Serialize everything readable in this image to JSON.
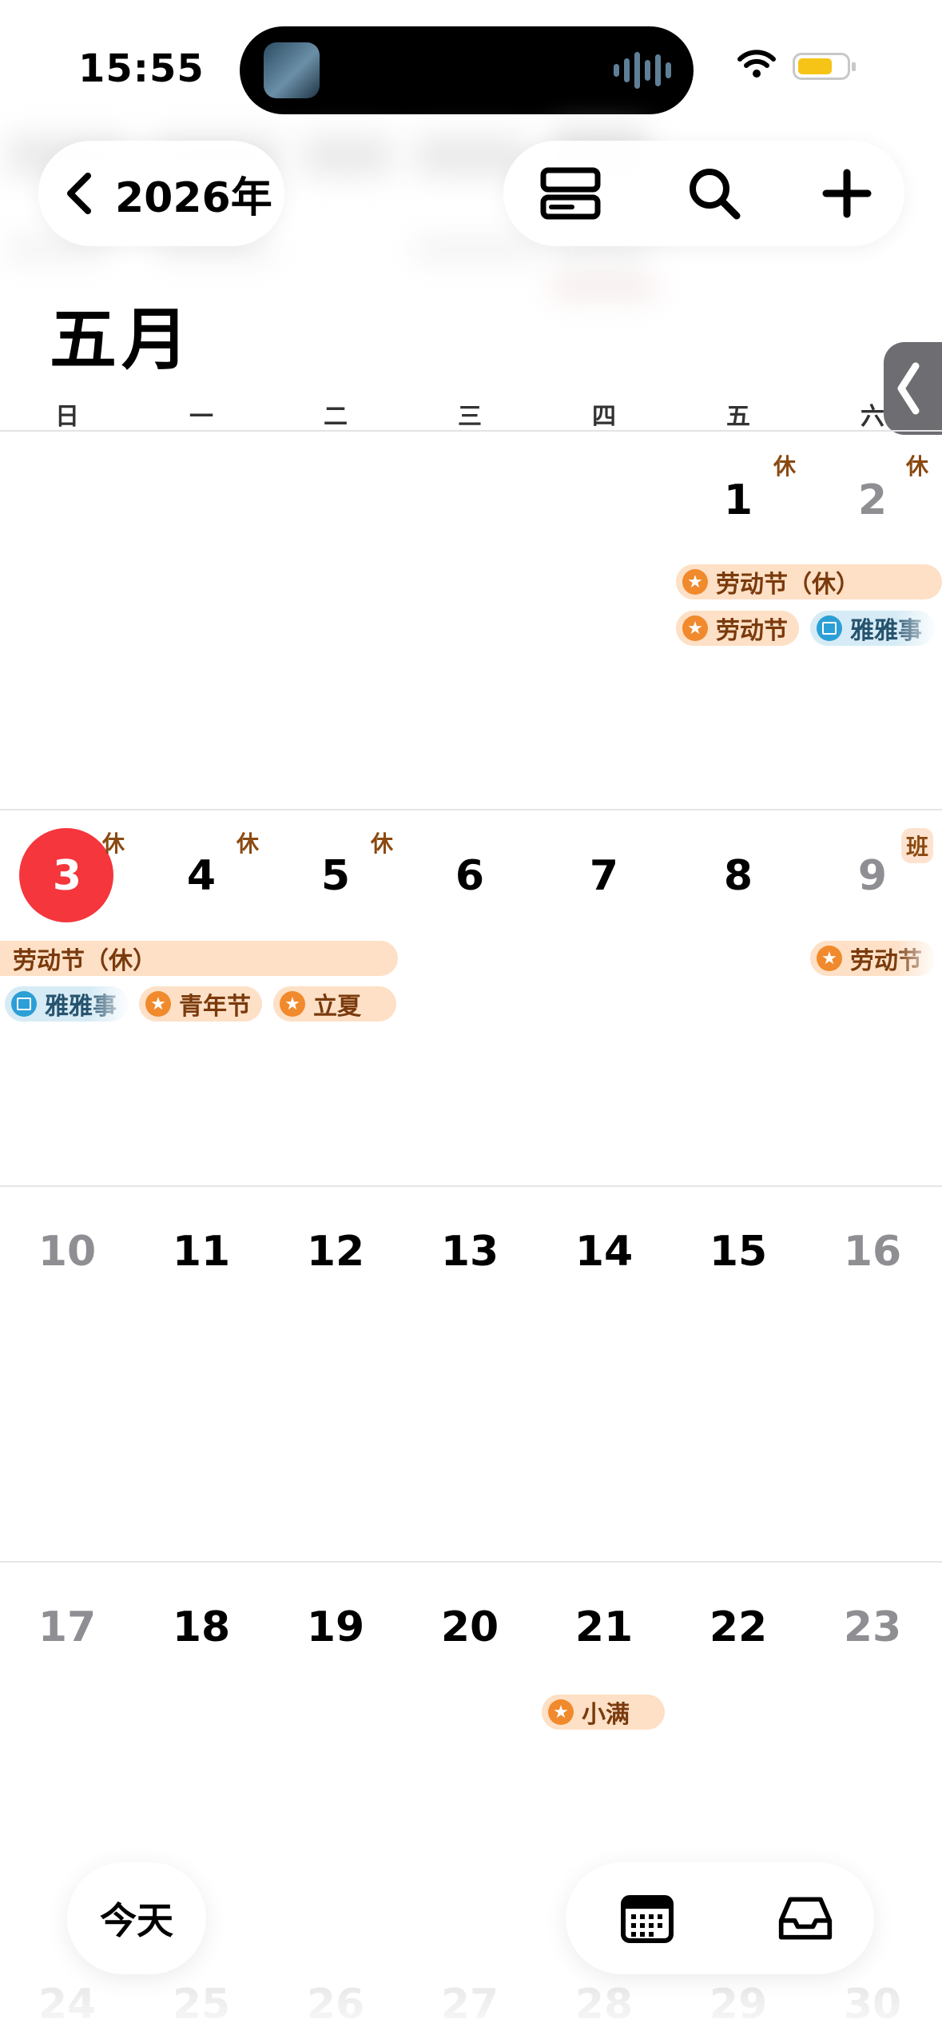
{
  "status_bar": {
    "time": "15:55"
  },
  "header": {
    "back_label": "2026年",
    "month_title": "五月"
  },
  "weekdays": [
    "日",
    "一",
    "二",
    "三",
    "四",
    "五",
    "六"
  ],
  "weeks": [
    {
      "days": [
        {
          "n": "",
          "style": "normal"
        },
        {
          "n": "",
          "style": "normal"
        },
        {
          "n": "",
          "style": "normal"
        },
        {
          "n": "",
          "style": "normal"
        },
        {
          "n": "",
          "style": "normal"
        },
        {
          "n": "1",
          "style": "normal",
          "badge": "休"
        },
        {
          "n": "2",
          "style": "dim",
          "badge": "休"
        }
      ],
      "events": [
        {
          "label": "劳动节（休）",
          "type": "banner"
        },
        {
          "label": "劳动节",
          "type": "holiday"
        },
        {
          "label": "雅雅事",
          "type": "calendar"
        }
      ]
    },
    {
      "days": [
        {
          "n": "3",
          "style": "today",
          "badge": "休"
        },
        {
          "n": "4",
          "style": "normal",
          "badge": "休"
        },
        {
          "n": "5",
          "style": "normal",
          "badge": "休"
        },
        {
          "n": "6",
          "style": "normal"
        },
        {
          "n": "7",
          "style": "normal"
        },
        {
          "n": "8",
          "style": "normal"
        },
        {
          "n": "9",
          "style": "dim",
          "badge": "班"
        }
      ],
      "events": [
        {
          "label": "劳动节（休）",
          "type": "banner"
        },
        {
          "label": "雅雅事",
          "type": "calendar"
        },
        {
          "label": "青年节",
          "type": "holiday"
        },
        {
          "label": "立夏",
          "type": "holiday"
        },
        {
          "label": "劳动节",
          "type": "holiday"
        }
      ]
    },
    {
      "days": [
        {
          "n": "10",
          "style": "dim"
        },
        {
          "n": "11",
          "style": "normal"
        },
        {
          "n": "12",
          "style": "normal"
        },
        {
          "n": "13",
          "style": "normal"
        },
        {
          "n": "14",
          "style": "normal"
        },
        {
          "n": "15",
          "style": "normal"
        },
        {
          "n": "16",
          "style": "dim"
        }
      ],
      "events": []
    },
    {
      "days": [
        {
          "n": "17",
          "style": "dim"
        },
        {
          "n": "18",
          "style": "normal"
        },
        {
          "n": "19",
          "style": "normal"
        },
        {
          "n": "20",
          "style": "normal"
        },
        {
          "n": "21",
          "style": "normal"
        },
        {
          "n": "22",
          "style": "normal"
        },
        {
          "n": "23",
          "style": "dim"
        }
      ],
      "events": [
        {
          "label": "小满",
          "type": "holiday"
        }
      ]
    },
    {
      "days": [
        {
          "n": "24",
          "style": "faint"
        },
        {
          "n": "25",
          "style": "faint"
        },
        {
          "n": "26",
          "style": "faint"
        },
        {
          "n": "27",
          "style": "faint"
        },
        {
          "n": "28",
          "style": "faint"
        },
        {
          "n": "29",
          "style": "faint"
        },
        {
          "n": "30",
          "style": "faint"
        }
      ],
      "events": []
    }
  ],
  "bottom": {
    "today_label": "今天"
  },
  "colors": {
    "today": "#f5363c",
    "holiday_bg": "#fde0c6",
    "holiday_icon": "#f08a2c",
    "calendar_bg": "#d6ebf5",
    "calendar_icon": "#2c9fd6"
  },
  "icons": [
    "back-chevron-icon",
    "list-view-icon",
    "search-icon",
    "plus-icon",
    "calendar-grid-icon",
    "inbox-icon",
    "wifi-icon",
    "battery-icon"
  ]
}
